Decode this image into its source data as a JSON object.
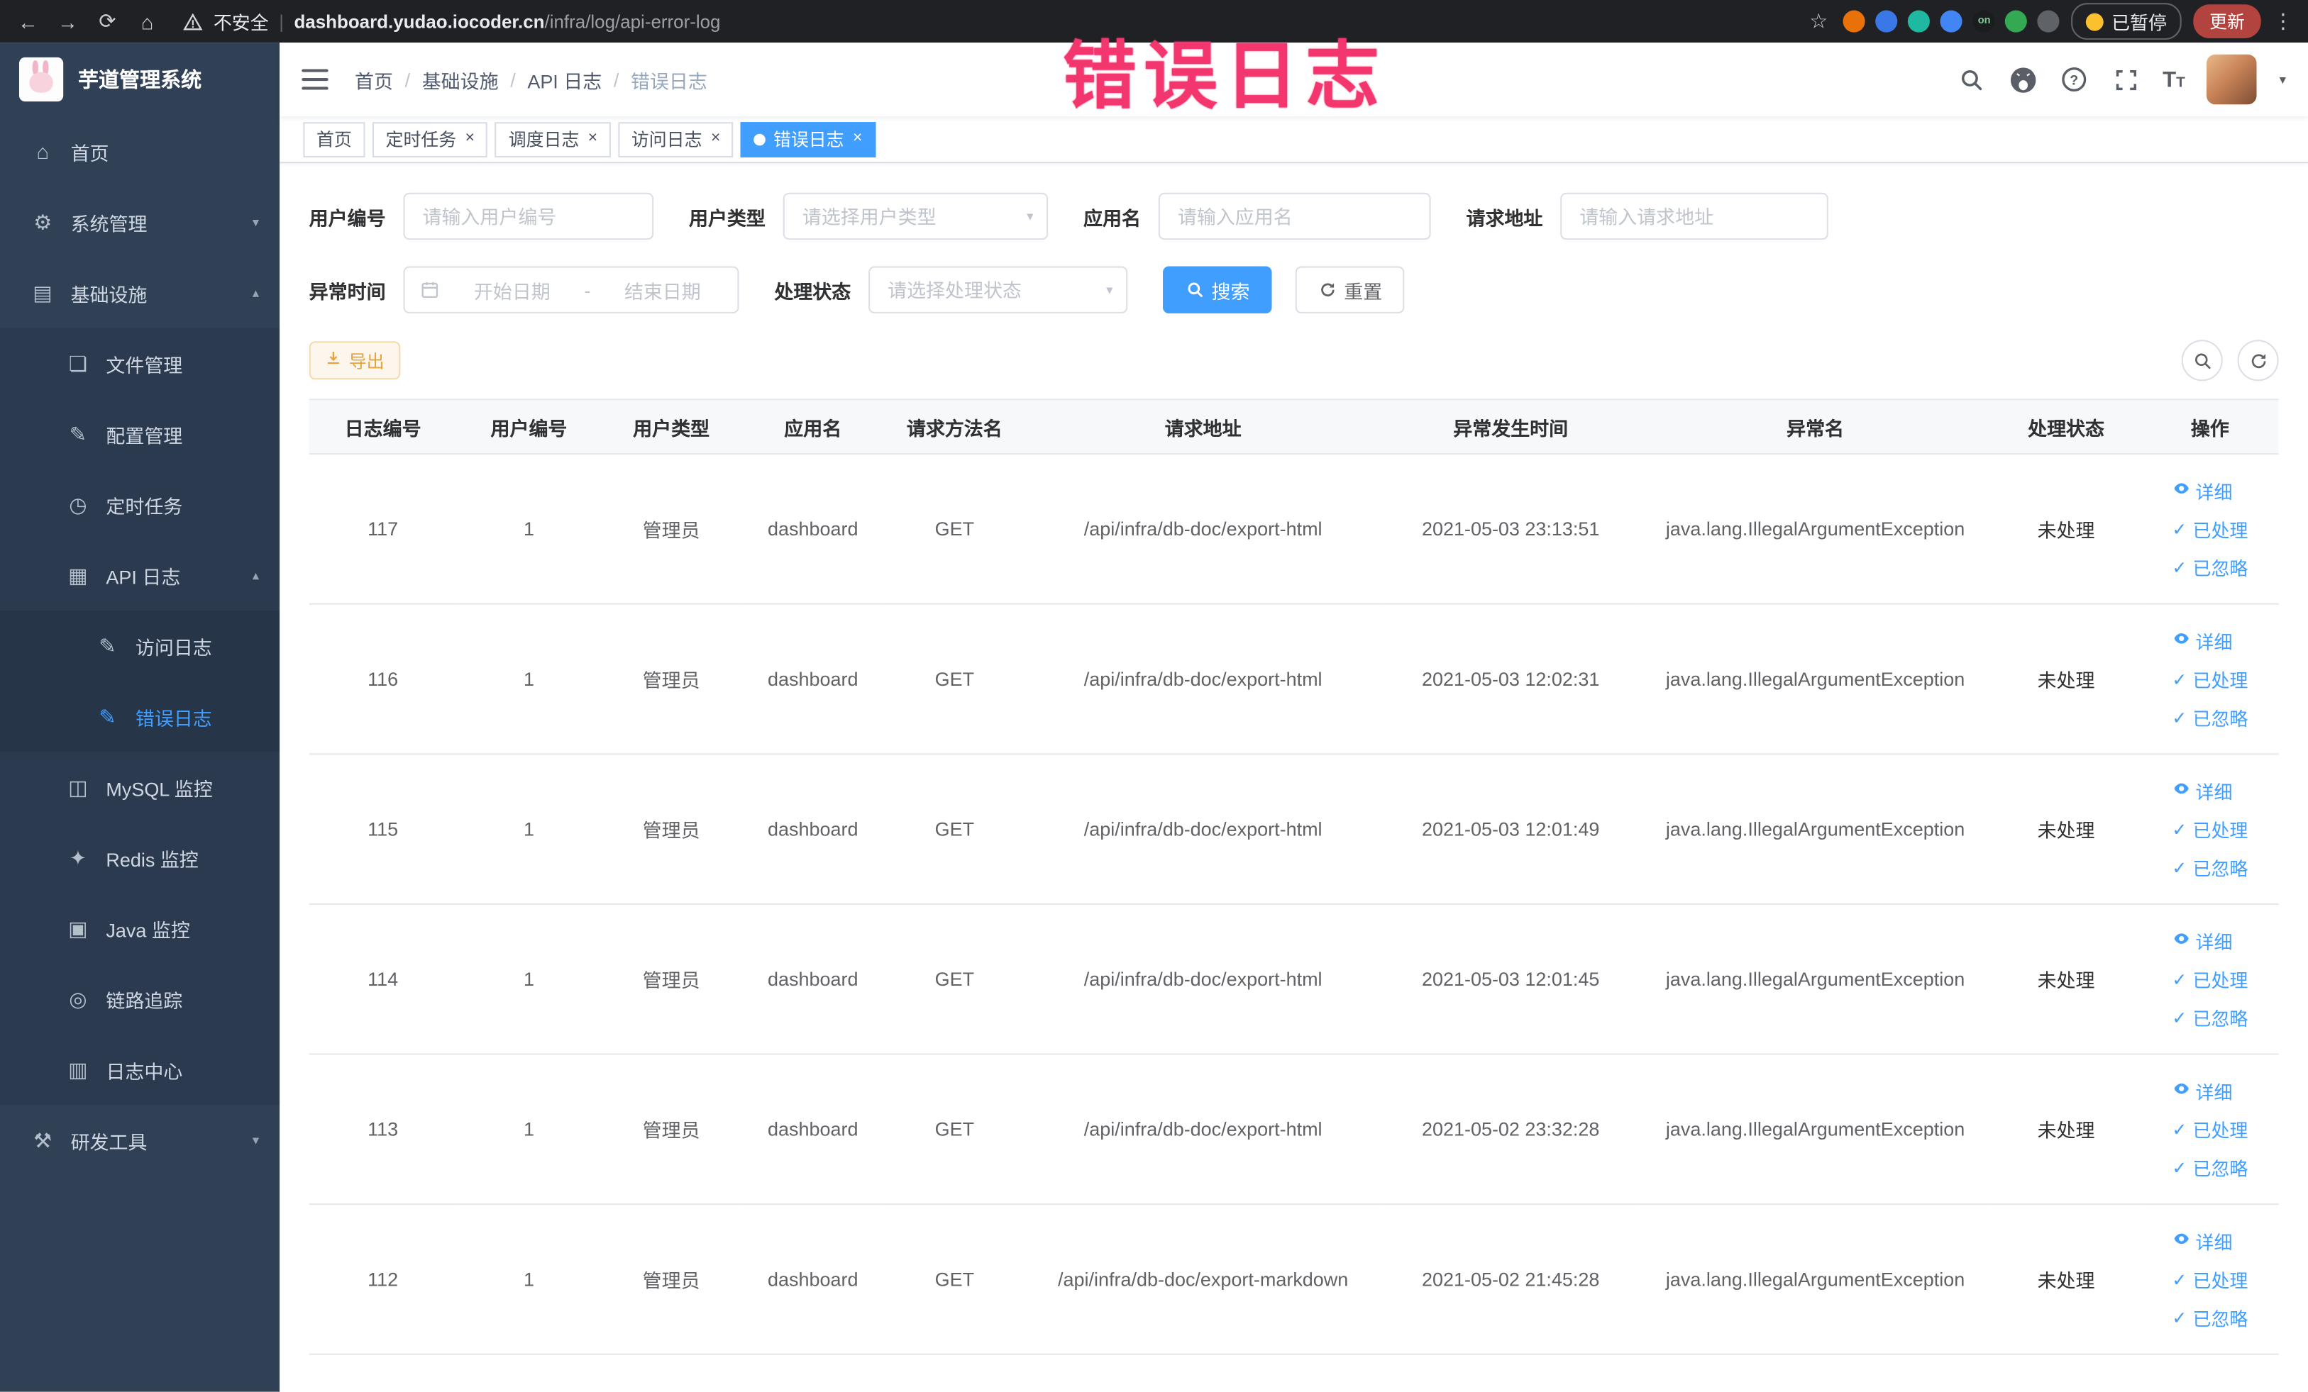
{
  "browser": {
    "security_label": "不安全",
    "url_host": "dashboard.yudao.iocoder.cn",
    "url_path": "/infra/log/api-error-log",
    "extensions": [
      {
        "color": "#e8710a"
      },
      {
        "color": "#3b78e7"
      },
      {
        "color": "#1eb9a0"
      },
      {
        "color": "#4285f4"
      },
      {
        "color": "#1a1c1e",
        "label": "on"
      },
      {
        "color": "#34a853"
      },
      {
        "color": "#5f6368"
      }
    ],
    "paused_badge": "已暂停",
    "update_button": "更新"
  },
  "annotation": {
    "text": "错误日志"
  },
  "sidebar": {
    "app_title": "芋道管理系统",
    "items": [
      {
        "id": "home",
        "label": "首页",
        "icon": "home-icon",
        "level": 1
      },
      {
        "id": "system-management",
        "label": "系统管理",
        "icon": "gear-icon",
        "level": 1,
        "chevron": "down"
      },
      {
        "id": "infrastructure",
        "label": "基础设施",
        "icon": "infrastructure-icon",
        "level": 1,
        "chevron": "up"
      },
      {
        "id": "file-management",
        "label": "文件管理",
        "icon": "file-icon",
        "level": 2
      },
      {
        "id": "config-management",
        "label": "配置管理",
        "icon": "config-icon",
        "level": 2
      },
      {
        "id": "scheduled-jobs",
        "label": "定时任务",
        "icon": "timer-icon",
        "level": 2
      },
      {
        "id": "api-log",
        "label": "API 日志",
        "icon": "api-log-icon",
        "level": 2,
        "chevron": "up"
      },
      {
        "id": "access-log",
        "label": "访问日志",
        "icon": "doc-edit-icon",
        "level": 3
      },
      {
        "id": "error-log",
        "label": "错误日志",
        "icon": "doc-edit-icon",
        "level": 3,
        "active": true
      },
      {
        "id": "mysql-monitor",
        "label": "MySQL 监控",
        "icon": "mysql-icon",
        "level": 2
      },
      {
        "id": "redis-monitor",
        "label": "Redis 监控",
        "icon": "redis-icon",
        "level": 2
      },
      {
        "id": "java-monitor",
        "label": "Java 监控",
        "icon": "java-icon",
        "level": 2
      },
      {
        "id": "trace",
        "label": "链路追踪",
        "icon": "trace-icon",
        "level": 2
      },
      {
        "id": "log-center",
        "label": "日志中心",
        "icon": "log-center-icon",
        "level": 2
      },
      {
        "id": "dev-tools",
        "label": "研发工具",
        "icon": "tools-icon",
        "level": 1,
        "chevron": "down"
      }
    ]
  },
  "header": {
    "breadcrumb": [
      "首页",
      "基础设施",
      "API 日志",
      "错误日志"
    ]
  },
  "tabs": [
    {
      "id": "home",
      "label": "首页",
      "closable": false,
      "active": false
    },
    {
      "id": "scheduled-jobs",
      "label": "定时任务",
      "closable": true,
      "active": false
    },
    {
      "id": "schedule-log",
      "label": "调度日志",
      "closable": true,
      "active": false
    },
    {
      "id": "access-log",
      "label": "访问日志",
      "closable": true,
      "active": false
    },
    {
      "id": "error-log",
      "label": "错误日志",
      "closable": true,
      "active": true
    }
  ],
  "filters": {
    "user_id": {
      "label": "用户编号",
      "placeholder": "请输入用户编号"
    },
    "user_type": {
      "label": "用户类型",
      "placeholder": "请选择用户类型"
    },
    "app_name": {
      "label": "应用名",
      "placeholder": "请输入应用名"
    },
    "request_url": {
      "label": "请求地址",
      "placeholder": "请输入请求地址"
    },
    "exception_time": {
      "label": "异常时间",
      "start_placeholder": "开始日期",
      "separator": "-",
      "end_placeholder": "结束日期"
    },
    "process_status": {
      "label": "处理状态",
      "placeholder": "请选择处理状态"
    },
    "search_label": "搜索",
    "reset_label": "重置"
  },
  "toolbar": {
    "export_label": "导出"
  },
  "table": {
    "columns": [
      "日志编号",
      "用户编号",
      "用户类型",
      "应用名",
      "请求方法名",
      "请求地址",
      "异常发生时间",
      "异常名",
      "处理状态",
      "操作"
    ],
    "actions": [
      {
        "name": "detail",
        "label": "详细",
        "icon": "eye-icon"
      },
      {
        "name": "processed",
        "label": "已处理",
        "icon": "check-icon"
      },
      {
        "name": "ignored",
        "label": "已忽略",
        "icon": "check-icon"
      }
    ],
    "rows": [
      {
        "id": "117",
        "user_id": "1",
        "user_type": "管理员",
        "app": "dashboard",
        "method": "GET",
        "url": "/api/infra/db-doc/export-html",
        "time": "2021-05-03 23:13:51",
        "exception": "java.lang.IllegalArgumentException",
        "status": "未处理"
      },
      {
        "id": "116",
        "user_id": "1",
        "user_type": "管理员",
        "app": "dashboard",
        "method": "GET",
        "url": "/api/infra/db-doc/export-html",
        "time": "2021-05-03 12:02:31",
        "exception": "java.lang.IllegalArgumentException",
        "status": "未处理"
      },
      {
        "id": "115",
        "user_id": "1",
        "user_type": "管理员",
        "app": "dashboard",
        "method": "GET",
        "url": "/api/infra/db-doc/export-html",
        "time": "2021-05-03 12:01:49",
        "exception": "java.lang.IllegalArgumentException",
        "status": "未处理"
      },
      {
        "id": "114",
        "user_id": "1",
        "user_type": "管理员",
        "app": "dashboard",
        "method": "GET",
        "url": "/api/infra/db-doc/export-html",
        "time": "2021-05-03 12:01:45",
        "exception": "java.lang.IllegalArgumentException",
        "status": "未处理"
      },
      {
        "id": "113",
        "user_id": "1",
        "user_type": "管理员",
        "app": "dashboard",
        "method": "GET",
        "url": "/api/infra/db-doc/export-html",
        "time": "2021-05-02 23:32:28",
        "exception": "java.lang.IllegalArgumentException",
        "status": "未处理"
      },
      {
        "id": "112",
        "user_id": "1",
        "user_type": "管理员",
        "app": "dashboard",
        "method": "GET",
        "url": "/api/infra/db-doc/export-markdown",
        "time": "2021-05-02 21:45:28",
        "exception": "java.lang.IllegalArgumentException",
        "status": "未处理"
      }
    ]
  },
  "colors": {
    "accent": "#409eff",
    "sidebar_bg": "#304156",
    "annotation": "#f3366e",
    "warning": "#e6a23c"
  }
}
